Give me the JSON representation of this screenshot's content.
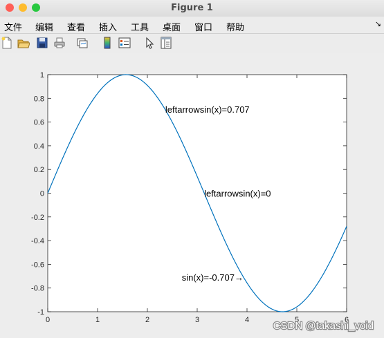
{
  "window": {
    "title": "Figure 1",
    "traffic_lights": {
      "close": "#ff5f57",
      "minimize": "#febc2e",
      "zoom": "#28c840"
    }
  },
  "menu": {
    "items": [
      "文件",
      "编辑",
      "查看",
      "插入",
      "工具",
      "桌面",
      "窗口",
      "帮助"
    ],
    "collapse_glyph": "↘"
  },
  "toolbar": {
    "buttons": [
      "new-figure-icon",
      "open-file-icon",
      "save-icon",
      "print-icon",
      "link-plot-icon",
      "colorbar-icon",
      "legend-icon",
      "pointer-icon",
      "property-inspector-icon"
    ]
  },
  "chart_data": {
    "type": "line",
    "title": "",
    "xlabel": "",
    "ylabel": "",
    "xlim": [
      0,
      6
    ],
    "ylim": [
      -1,
      1
    ],
    "xticks": [
      "0",
      "1",
      "2",
      "3",
      "4",
      "5",
      "6"
    ],
    "yticks": [
      "1",
      "0.8",
      "0.6",
      "0.4",
      "0.2",
      "0",
      "-0.2",
      "-0.4",
      "-0.6",
      "-0.8",
      "-1"
    ],
    "grid": false,
    "series": [
      {
        "function": "sin(x)",
        "color": "#0072bd",
        "x": [
          0,
          0.25,
          0.5,
          0.75,
          1,
          1.25,
          1.5,
          1.75,
          2,
          2.25,
          2.5,
          2.75,
          3,
          3.25,
          3.5,
          3.75,
          4,
          4.25,
          4.5,
          4.75,
          5,
          5.25,
          5.5,
          5.75,
          6
        ],
        "y": [
          0,
          0.247,
          0.479,
          0.682,
          0.841,
          0.949,
          0.997,
          0.984,
          0.909,
          0.778,
          0.598,
          0.382,
          0.141,
          -0.108,
          -0.351,
          -0.572,
          -0.757,
          -0.895,
          -0.978,
          -0.999,
          -0.959,
          -0.859,
          -0.706,
          -0.508,
          -0.279
        ]
      }
    ],
    "annotations": [
      {
        "text": "leftarrowsin(x)=0.707",
        "x": 2.36,
        "y": 0.707,
        "anchor": "start"
      },
      {
        "text": "leftarrowsin(x)=0",
        "x": 3.14,
        "y": 0,
        "anchor": "start"
      },
      {
        "text": "sin(x)=-0.707→",
        "x": 3.93,
        "y": -0.707,
        "anchor": "end"
      }
    ]
  },
  "watermark": "CSDN @takashi_void"
}
